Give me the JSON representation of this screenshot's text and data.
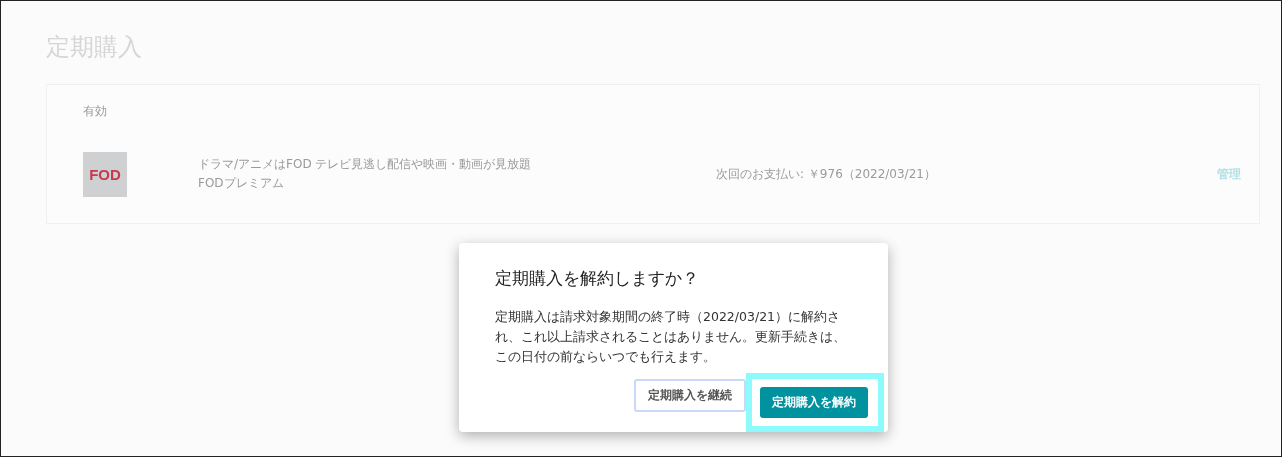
{
  "page": {
    "title": "定期購入"
  },
  "subscriptions": {
    "section": "有効",
    "items": [
      {
        "logo": "FOD",
        "description": "ドラマ/アニメはFOD テレビ見逃し配信や映画・動画が見放題",
        "name": "FODプレミアム",
        "payment": "次回のお支払い: ￥976（2022/03/21）",
        "action": "管理"
      }
    ]
  },
  "dialog": {
    "title": "定期購入を解約しますか？",
    "body": "定期購入は請求対象期間の終了時（2022/03/21）に解約され、これ以上請求されることはありません。更新手続きは、この日付の前ならいつでも行えます。",
    "buttons": [
      {
        "label": "定期購入を継続",
        "kind": "secondary",
        "highlighted": false
      },
      {
        "label": "定期購入を解約",
        "kind": "primary",
        "highlighted": true
      }
    ]
  }
}
